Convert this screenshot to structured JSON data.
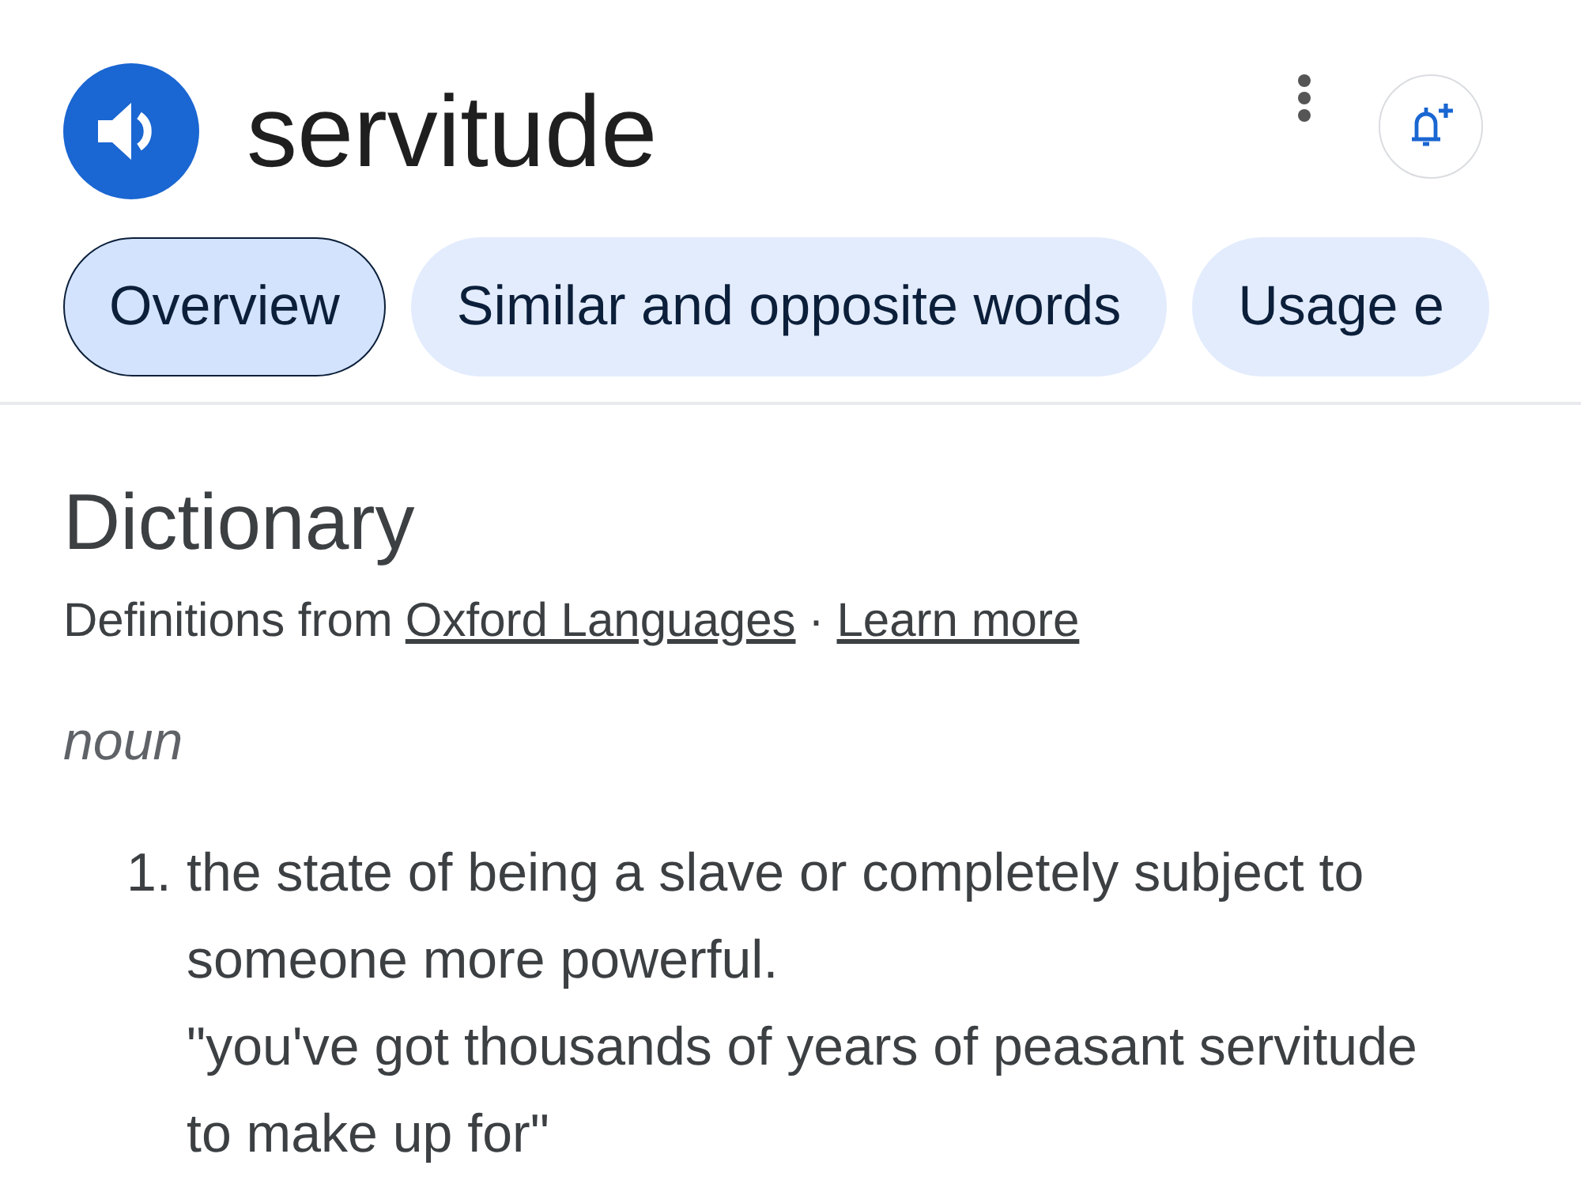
{
  "header": {
    "word": "servitude"
  },
  "tabs": [
    {
      "label": "Overview",
      "selected": true
    },
    {
      "label": "Similar and opposite words",
      "selected": false
    },
    {
      "label": "Usage e",
      "selected": false
    }
  ],
  "dictionary": {
    "title": "Dictionary",
    "source_prefix": "Definitions from",
    "source_link": "Oxford Languages",
    "separator": "·",
    "learn_more": "Learn more",
    "part_of_speech": "noun",
    "senses": [
      {
        "number": "1.",
        "definition": "the state of being a slave or completely subject to someone more powerful.",
        "example": "\"you've got thousands of years of peasant servitude to make up for\""
      }
    ]
  }
}
